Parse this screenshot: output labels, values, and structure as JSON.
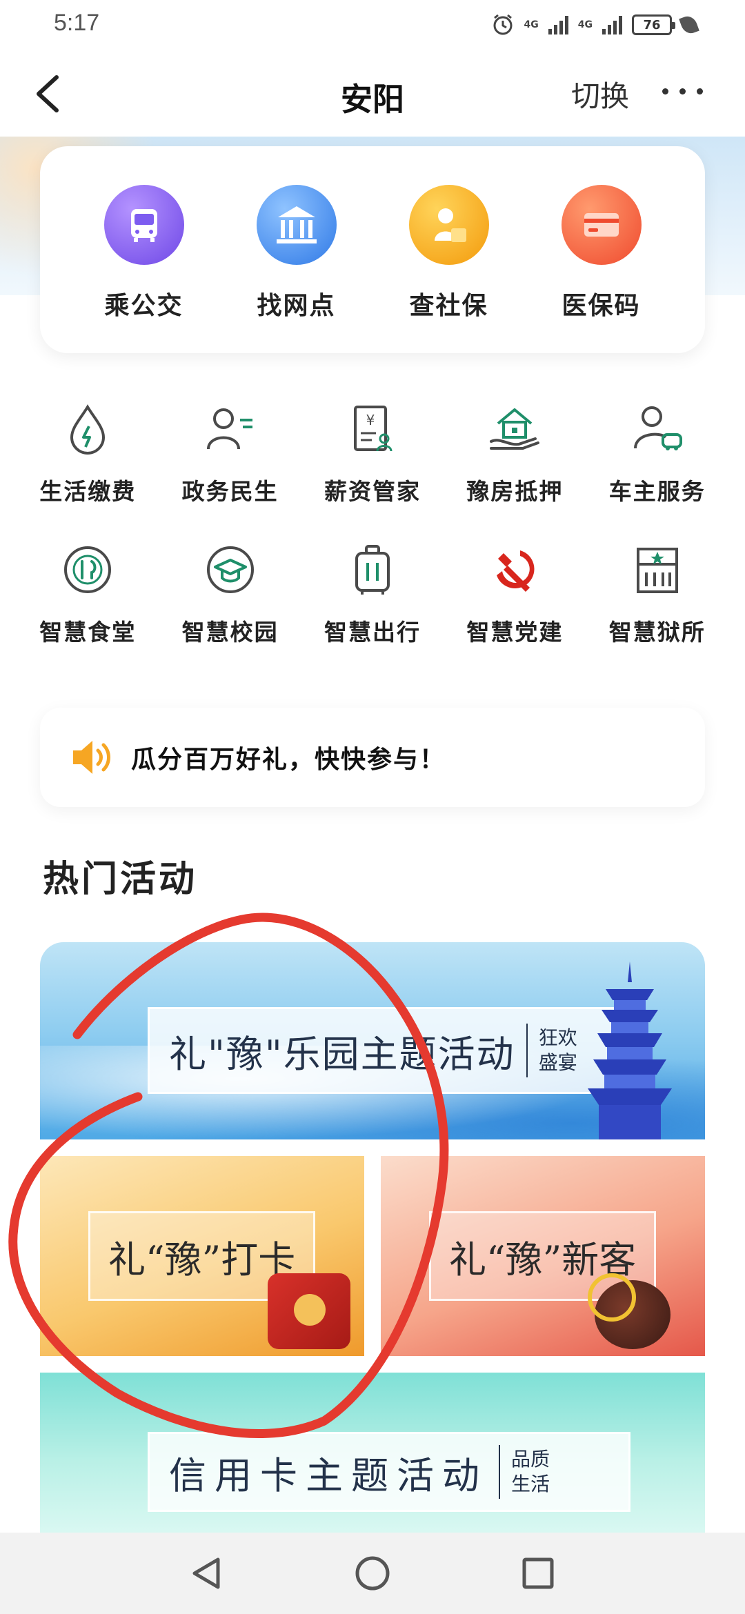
{
  "status_bar": {
    "time": "5:17",
    "net1": "4G",
    "net2": "4G",
    "battery": "76"
  },
  "nav": {
    "title": "安阳",
    "switch_label": "切换"
  },
  "quick_services": [
    {
      "label": "乘公交",
      "icon": "bus-icon",
      "color": "#7d5cf0"
    },
    {
      "label": "找网点",
      "icon": "bank-icon",
      "color": "#3f8ff0"
    },
    {
      "label": "查社保",
      "icon": "social-security-icon",
      "color": "#f7a614"
    },
    {
      "label": "医保码",
      "icon": "card-icon",
      "color": "#f4563a"
    }
  ],
  "services": [
    {
      "label": "生活缴费",
      "icon": "water-drop-icon"
    },
    {
      "label": "政务民生",
      "icon": "person-list-icon"
    },
    {
      "label": "薪资管家",
      "icon": "payslip-icon"
    },
    {
      "label": "豫房抵押",
      "icon": "house-hand-icon"
    },
    {
      "label": "车主服务",
      "icon": "person-car-icon"
    },
    {
      "label": "智慧食堂",
      "icon": "dining-icon"
    },
    {
      "label": "智慧校园",
      "icon": "graduation-cap-icon"
    },
    {
      "label": "智慧出行",
      "icon": "suitcase-icon"
    },
    {
      "label": "智慧党建",
      "icon": "hammer-sickle-icon"
    },
    {
      "label": "智慧狱所",
      "icon": "building-icon"
    }
  ],
  "notice": {
    "text": "瓜分百万好礼，快快参与！"
  },
  "section_title": "热门活动",
  "banners": {
    "main": {
      "big": "礼\"豫\"乐园主题活动",
      "small": "狂欢盛宴"
    },
    "left": {
      "text": "礼“豫”打卡"
    },
    "right": {
      "text": "礼“豫”新客"
    },
    "bottom": {
      "big": "信用卡主题活动",
      "small": "品质生活"
    }
  },
  "colors": {
    "brand_green": "#1f8f6a",
    "party_red": "#d8261d",
    "scribble_red": "#e53a2f"
  }
}
